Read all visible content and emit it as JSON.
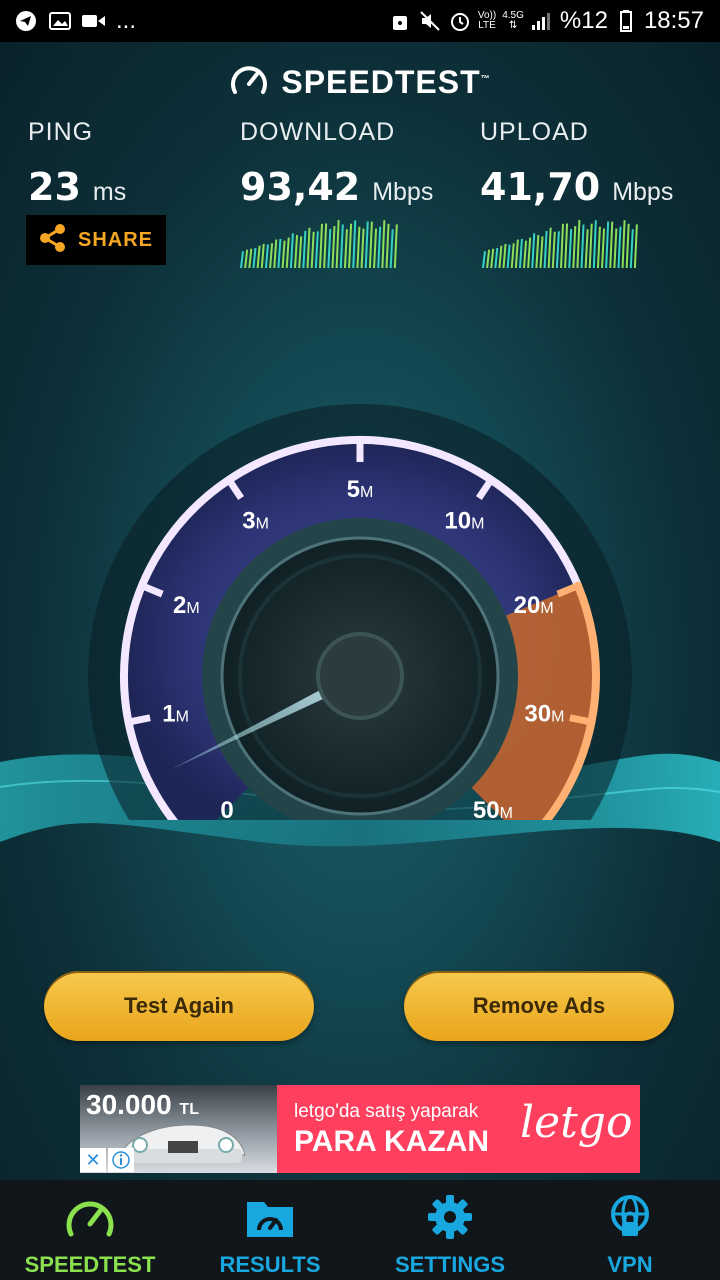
{
  "status_bar": {
    "more": "...",
    "network_top": "4.5G",
    "volte_top": "Vo))",
    "volte_bottom": "LTE",
    "battery": "%12",
    "time": "18:57"
  },
  "brand": {
    "name": "SPEEDTEST",
    "tm": "™"
  },
  "metrics": {
    "ping": {
      "label": "PING",
      "value": "23",
      "unit": "ms"
    },
    "download": {
      "label": "DOWNLOAD",
      "value": "93,42",
      "unit": "Mbps"
    },
    "upload": {
      "label": "UPLOAD",
      "value": "41,70",
      "unit": "Mbps"
    }
  },
  "share": {
    "label": "SHARE"
  },
  "gauge": {
    "ticks": [
      {
        "n": "0",
        "s": ""
      },
      {
        "n": "1",
        "s": "M"
      },
      {
        "n": "2",
        "s": "M"
      },
      {
        "n": "3",
        "s": "M"
      },
      {
        "n": "5",
        "s": "M"
      },
      {
        "n": "10",
        "s": "M"
      },
      {
        "n": "20",
        "s": "M"
      },
      {
        "n": "30",
        "s": "M"
      },
      {
        "n": "50",
        "s": "M"
      }
    ]
  },
  "buttons": {
    "test_again": "Test Again",
    "remove_ads": "Remove Ads"
  },
  "ad": {
    "price": "30.000",
    "price_unit": "TL",
    "line1": "letgo'da satış yaparak",
    "line2": "PARA KAZAN",
    "logo": "letgo"
  },
  "nav": {
    "items": [
      {
        "label": "SPEEDTEST",
        "icon": "speedometer-icon"
      },
      {
        "label": "RESULTS",
        "icon": "results-folder-icon"
      },
      {
        "label": "SETTINGS",
        "icon": "gear-icon"
      },
      {
        "label": "VPN",
        "icon": "globe-lock-icon"
      }
    ]
  },
  "colors": {
    "accent_orange": "#f5a623",
    "nav_active": "#8be04e",
    "nav_inactive": "#19a7e0",
    "ad_bg": "#ff3f5e"
  }
}
